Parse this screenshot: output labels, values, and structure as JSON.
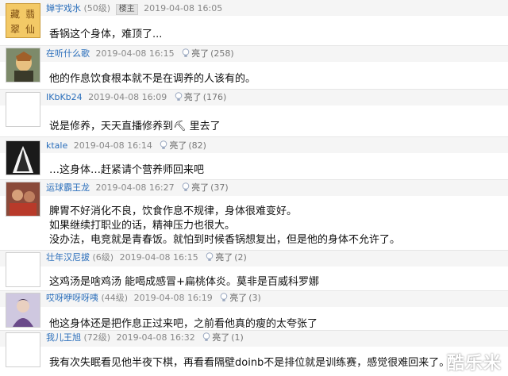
{
  "posts": [
    {
      "user": "婵宇戏水",
      "level": "(50级)",
      "badge": "楼主",
      "time": "2019-04-08 16:05",
      "lines": [
        "香锅这个身体，难顶了..."
      ]
    },
    {
      "user": "在听什么歌",
      "level": "",
      "time": "2019-04-08 16:15",
      "like_label": "亮了",
      "likes": "(258)",
      "lines": [
        "他的作息饮食根本就不是在调养的人该有的。"
      ]
    },
    {
      "user": "IKbKb24",
      "level": "",
      "time": "2019-04-08 16:09",
      "like_label": "亮了",
      "likes": "(176)",
      "lines": [
        "说是修养，天天直播修养到⛏ 里去了"
      ]
    },
    {
      "user": "ktale",
      "level": "",
      "time": "2019-04-08 16:14",
      "like_label": "亮了",
      "likes": "(82)",
      "lines": [
        "…这身体…赶紧请个营养师回来吧"
      ]
    },
    {
      "user": "运球霸王龙",
      "level": "",
      "time": "2019-04-08 16:27",
      "like_label": "亮了",
      "likes": "(37)",
      "lines": [
        "脾胃不好消化不良，饮食作息不规律，身体很难变好。",
        "如果继续打职业的话，精神压力也很大。",
        "没办法，电竞就是青春饭。就怕到时候香锅想复出，但是他的身体不允许了。"
      ]
    },
    {
      "user": "壮年汉尼拔",
      "level": "(6级)",
      "time": "2019-04-08 16:15",
      "like_label": "亮了",
      "likes": "(2)",
      "lines": [
        "这鸡汤是啥鸡汤 能喝成感冒+扁桃体炎。莫非是百威科罗娜"
      ]
    },
    {
      "user": "哎呀咿呀呀咦",
      "level": "(44级)",
      "time": "2019-04-08 16:19",
      "like_label": "亮了",
      "likes": "(3)",
      "lines": [
        "他这身体还是把作息正过来吧，之前看他真的瘦的太夸张了"
      ]
    },
    {
      "user": "我儿王旭",
      "level": "(72级)",
      "time": "2019-04-08 16:32",
      "like_label": "亮了",
      "likes": "(1)",
      "lines": [
        "我有次失眠看见他半夜下棋，再看看隔壁doinb不是排位就是训练赛，感觉很难回来了。"
      ]
    }
  ],
  "watermark": "酷乐米"
}
